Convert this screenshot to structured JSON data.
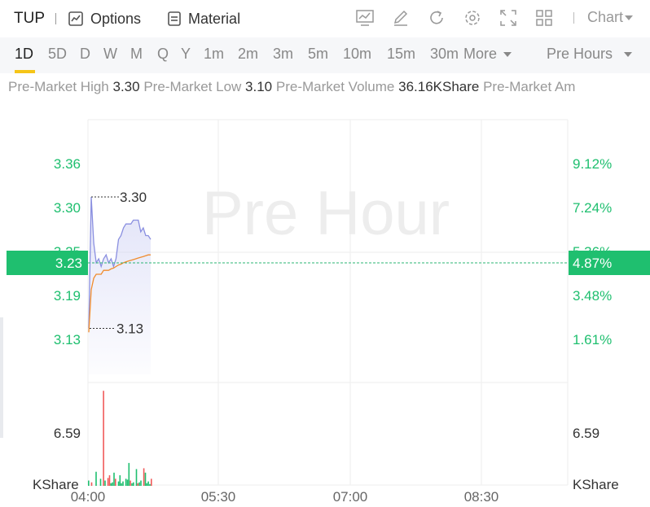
{
  "toolbar": {
    "ticker": "TUP",
    "options_label": "Options",
    "material_label": "Material",
    "tools": [
      "chart-type-icon",
      "draw-icon",
      "refresh-icon",
      "settings-icon",
      "fullscreen-icon",
      "layout-grid-icon"
    ],
    "chart_label": "Chart"
  },
  "periods": {
    "tabs": [
      "1D",
      "5D",
      "D",
      "W",
      "M",
      "Q",
      "Y",
      "1m",
      "2m",
      "3m",
      "5m",
      "10m",
      "15m",
      "30m"
    ],
    "active": "1D",
    "more_label": "More",
    "session_label": "Pre Hours"
  },
  "info": {
    "high_label": "Pre-Market High",
    "high_value": "3.30",
    "low_label": "Pre-Market Low",
    "low_value": "3.10",
    "volume_label": "Pre-Market Volume",
    "volume_value": "36.16KShare",
    "amount_label": "Pre-Market Am"
  },
  "colors": {
    "up": "#1fbf6f",
    "down": "#f05a5a",
    "price_line": "#8a8fe0",
    "avg_line": "#f08c2e",
    "grid": "#eeeeee"
  },
  "chart_data": {
    "type": "line",
    "watermark": "Pre Hour",
    "x_ticks": [
      "04:00",
      "05:30",
      "07:00",
      "08:30"
    ],
    "price_ticks": [
      "3.36",
      "3.30",
      "3.25",
      "3.19",
      "3.13"
    ],
    "pct_ticks": [
      "9.12%",
      "7.24%",
      "5.36%",
      "3.48%",
      "1.61%"
    ],
    "ylim": [
      3.06,
      3.4
    ],
    "current_price": "3.23",
    "current_pct": "4.87%",
    "high_label": "3.30",
    "low_label": "3.13",
    "high_value": 3.3,
    "low_value": 3.13,
    "price": [
      3.13,
      3.3,
      3.24,
      3.215,
      3.22,
      3.21,
      3.22,
      3.225,
      3.215,
      3.22,
      3.21,
      3.22,
      3.245,
      3.25,
      3.26,
      3.265,
      3.265,
      3.265,
      3.27,
      3.27,
      3.27,
      3.255,
      3.26,
      3.25,
      3.25,
      3.245
    ],
    "avg": [
      3.125,
      3.18,
      3.195,
      3.2,
      3.2,
      3.2,
      3.205,
      3.205,
      3.205,
      3.207,
      3.208,
      3.21,
      3.212,
      3.213,
      3.215,
      3.216,
      3.217,
      3.218,
      3.219,
      3.22,
      3.221,
      3.222,
      3.223,
      3.224,
      3.225,
      3.225
    ],
    "volume_axis_label": "6.59",
    "volume_unit": "KShare",
    "volume_max": 11.0,
    "volume": [
      0.6,
      0.0,
      0.4,
      0.0,
      0.0,
      1.6,
      0.0,
      0.0,
      0.8,
      0.0,
      10.8,
      0.6,
      0.0,
      0.9,
      1.2,
      0.3,
      0.4,
      1.5,
      0.8,
      0.0,
      0.5,
      1.2,
      0.3,
      0.5,
      0.0,
      0.8,
      0.7,
      2.6,
      0.6,
      0.3,
      0.4,
      0.0,
      1.9,
      0.3,
      0.4,
      0.6,
      0.0,
      2.0,
      1.5,
      0.3,
      0.5,
      0.2,
      0.8
    ],
    "volume_dir": [
      "up",
      "up",
      "down",
      "up",
      "up",
      "up",
      "up",
      "up",
      "up",
      "up",
      "down",
      "up",
      "up",
      "down",
      "down",
      "up",
      "up",
      "up",
      "down",
      "up",
      "up",
      "up",
      "up",
      "up",
      "up",
      "up",
      "up",
      "up",
      "down",
      "up",
      "up",
      "up",
      "up",
      "down",
      "up",
      "up",
      "up",
      "down",
      "up",
      "up",
      "up",
      "up",
      "down"
    ]
  }
}
